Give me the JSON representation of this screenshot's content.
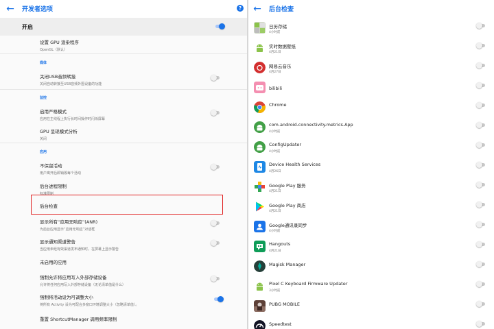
{
  "colors": {
    "accent": "#1a73e8",
    "highlight": "#e02020"
  },
  "left": {
    "title": "开发者选项",
    "help_icon": "?",
    "master": {
      "label": "开启",
      "on": true
    },
    "prefs": [
      {
        "title": "设置 GPU 渲染程序",
        "summary": "OpenGL（默认）"
      },
      {
        "category": "媒体"
      },
      {
        "title": "关闭USB音频转接",
        "summary": "关闭自动转接至USB音频外围设备的功能",
        "switch": false
      },
      {
        "category": "监控"
      },
      {
        "title": "启用严格模式",
        "summary": "应用在主线程上执行长时间操作时闪烁屏幕",
        "switch": false
      },
      {
        "title": "GPU 呈现模式分析",
        "summary": "关闭"
      },
      {
        "category": "应用"
      },
      {
        "title": "不保留活动",
        "summary": "用户离开后即销毁每个活动",
        "switch": false
      },
      {
        "title": "后台进程限制",
        "summary": "标准限制"
      },
      {
        "title": "后台检查",
        "summary": ""
      },
      {
        "title": "显示所有“应用无响应”(ANR)",
        "summary": "为后台应用显示“应用无响应”对话框",
        "switch": false
      },
      {
        "title": "显示通知渠道警告",
        "summary": "当应用未经有效渠道发布通知时，在屏幕上显示警告",
        "switch": false
      },
      {
        "title": "未启用的应用",
        "summary": ""
      },
      {
        "title": "强制允许将应用写入外部存储设备",
        "summary": "允许将任何应用写入外部存储设备（无论清单值是什么）",
        "switch": false
      },
      {
        "title": "强制将活动设为可调整大小",
        "summary": "将所有 Activity 设为可配合多窗口环境调整大小（忽略清单值）。",
        "switch": true
      },
      {
        "title": "重置 ShortcutManager 调用频率限制",
        "summary": ""
      }
    ]
  },
  "right": {
    "title": "后台检查",
    "apps": [
      {
        "name": "日历存储",
        "time": "4小时前",
        "icon": "calendar-storage-icon"
      },
      {
        "name": "实时数据壁纸",
        "time": "4月21日",
        "icon": "android-icon"
      },
      {
        "name": "网易云音乐",
        "time": "4月27日",
        "icon": "netease-music-icon"
      },
      {
        "name": "bilibili",
        "time": "",
        "icon": "bilibili-icon"
      },
      {
        "name": "Chrome",
        "time": "",
        "icon": "chrome-icon"
      },
      {
        "name": "com.android.connectivity.metrics.App",
        "time": "4小时前",
        "icon": "android-icon"
      },
      {
        "name": "ConfigUpdater",
        "time": "4小时前",
        "icon": "android-icon"
      },
      {
        "name": "Device Health Services",
        "time": "4月26日",
        "icon": "device-health-icon"
      },
      {
        "name": "Google Play 服务",
        "time": "4月21日",
        "icon": "play-services-icon"
      },
      {
        "name": "Google Play 商店",
        "time": "4月21日",
        "icon": "play-store-icon"
      },
      {
        "name": "Google通讯录同步",
        "time": "4小时前",
        "icon": "contacts-sync-icon"
      },
      {
        "name": "Hangouts",
        "time": "4月21日",
        "icon": "hangouts-icon"
      },
      {
        "name": "Magisk Manager",
        "time": "",
        "icon": "magisk-icon"
      },
      {
        "name": "Pixel C Keyboard Firmware Updater",
        "time": "3小时前",
        "icon": "android-icon"
      },
      {
        "name": "PUBG MOBILE",
        "time": "",
        "icon": "pubg-icon"
      },
      {
        "name": "Speedtest",
        "time": "",
        "icon": "speedtest-icon"
      }
    ]
  }
}
